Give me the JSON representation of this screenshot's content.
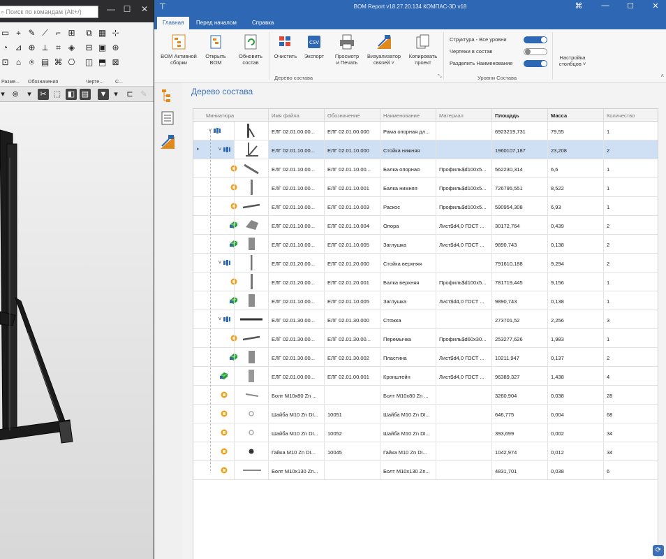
{
  "kompas": {
    "search_placeholder": "Поиск по командам (Alt+/)",
    "group_labels": [
      "Разме...",
      "Обозначения",
      "Черте...",
      "С..."
    ]
  },
  "bom": {
    "title": "BOM Report v18.27.20.134 КОМПАС-3D v18",
    "tabs": [
      "Главная",
      "Перед началом",
      "Справка"
    ],
    "active_tab": "Главная",
    "ribbon": {
      "buttons": [
        {
          "label": "BOM Активной\nсборки"
        },
        {
          "label": "Открыть\nBOM"
        },
        {
          "label": "Обновить\nсостав"
        },
        {
          "label": "Очистить"
        },
        {
          "label": "Экспорт"
        },
        {
          "label": "Просмотр\nи Печать"
        },
        {
          "label": "Визуализатор\nсвязей ˅"
        },
        {
          "label": "Копировать\nпроект"
        }
      ],
      "toggles": [
        {
          "label": "Структура - Все уровни",
          "on": true
        },
        {
          "label": "Чертежи в состав",
          "on": false
        },
        {
          "label": "Разделить Наименование",
          "on": true
        }
      ],
      "columns_button": "Настройка\nстолбцов ˅",
      "group_labels": [
        "Дерево состава",
        "Уровни Состава"
      ]
    },
    "heading": "Дерево состава",
    "columns": [
      "Миниатюра",
      "Имя файла",
      "Обозначение",
      "Наименование",
      "Материал",
      "Площадь",
      "Масса",
      "Количество"
    ],
    "rows": [
      {
        "level": 0,
        "expand": "˅",
        "kind": "asm",
        "file": "ЕЛГ 02.01.00.00...",
        "designation": "ЕЛГ 02.01.00.000",
        "name": "Рама опорная дл...",
        "material": "",
        "area": "6923219,731",
        "mass": "79,55",
        "qty": "1"
      },
      {
        "level": 1,
        "expand": "˅",
        "kind": "asm",
        "file": "ЕЛГ 02.01.10.00...",
        "designation": "ЕЛГ 02.01.10.000",
        "name": "Стойка нижняя",
        "material": "",
        "area": "1960107,187",
        "mass": "23,208",
        "qty": "2",
        "selected": true
      },
      {
        "level": 2,
        "expand": "",
        "kind": "weld",
        "file": "ЕЛГ 02.01.10.00...",
        "designation": "ЕЛГ 02.01.10.00...",
        "name": "Балка опорная",
        "material": "Профиль$d100x5...",
        "area": "562230,314",
        "mass": "6,6",
        "qty": "1"
      },
      {
        "level": 2,
        "expand": "",
        "kind": "weld",
        "file": "ЕЛГ 02.01.10.00...",
        "designation": "ЕЛГ 02.01.10.001",
        "name": "Балка нижняя",
        "material": "Профиль$d100x5...",
        "area": "726795,551",
        "mass": "8,522",
        "qty": "1"
      },
      {
        "level": 2,
        "expand": "",
        "kind": "weld",
        "file": "ЕЛГ 02.01.10.00...",
        "designation": "ЕЛГ 02.01.10.003",
        "name": "Раскос",
        "material": "Профиль$d100x5...",
        "area": "590954,308",
        "mass": "6,93",
        "qty": "1"
      },
      {
        "level": 2,
        "expand": "",
        "kind": "part",
        "file": "ЕЛГ 02.01.10.00...",
        "designation": "ЕЛГ 02.01.10.004",
        "name": "Опора",
        "material": "Лист$d4,0 ГОСТ ...",
        "area": "30172,764",
        "mass": "0,439",
        "qty": "2"
      },
      {
        "level": 2,
        "expand": "",
        "kind": "part",
        "file": "ЕЛГ 02.01.10.00...",
        "designation": "ЕЛГ 02.01.10.005",
        "name": "Заглушка",
        "material": "Лист$d4,0 ГОСТ ...",
        "area": "9890,743",
        "mass": "0,138",
        "qty": "2"
      },
      {
        "level": 1,
        "expand": "˅",
        "kind": "asm",
        "file": "ЕЛГ 02.01.20.00...",
        "designation": "ЕЛГ 02.01.20.000",
        "name": "Стойка верхняя",
        "material": "",
        "area": "791610,188",
        "mass": "9,294",
        "qty": "2"
      },
      {
        "level": 2,
        "expand": "",
        "kind": "weld",
        "file": "ЕЛГ 02.01.20.00...",
        "designation": "ЕЛГ 02.01.20.001",
        "name": "Балка верхняя",
        "material": "Профиль$d100x5...",
        "area": "781719,445",
        "mass": "9,156",
        "qty": "1"
      },
      {
        "level": 2,
        "expand": "",
        "kind": "part",
        "file": "ЕЛГ 02.01.10.00...",
        "designation": "ЕЛГ 02.01.10.005",
        "name": "Заглушка",
        "material": "Лист$d4,0 ГОСТ ...",
        "area": "9890,743",
        "mass": "0,138",
        "qty": "1"
      },
      {
        "level": 1,
        "expand": "˅",
        "kind": "asm",
        "file": "ЕЛГ 02.01.30.00...",
        "designation": "ЕЛГ 02.01.30.000",
        "name": "Стяжка",
        "material": "",
        "area": "273701,52",
        "mass": "2,256",
        "qty": "3"
      },
      {
        "level": 2,
        "expand": "",
        "kind": "weld",
        "file": "ЕЛГ 02.01.30.00...",
        "designation": "ЕЛГ 02.01.30.00...",
        "name": "Перемычка",
        "material": "Профиль$d60x30...",
        "area": "253277,626",
        "mass": "1,983",
        "qty": "1"
      },
      {
        "level": 2,
        "expand": "",
        "kind": "part",
        "file": "ЕЛГ 02.01.30.00...",
        "designation": "ЕЛГ 02.01.30.002",
        "name": "Пластина",
        "material": "Лист$d4,0 ГОСТ ...",
        "area": "10211,947",
        "mass": "0,137",
        "qty": "2"
      },
      {
        "level": 1,
        "expand": "",
        "kind": "part",
        "file": "ЕЛГ 02.01.00.00...",
        "designation": "ЕЛГ 02.01.00.001",
        "name": "Кронштейн",
        "material": "Лист$d4,0 ГОСТ ...",
        "area": "96389,327",
        "mass": "1,438",
        "qty": "4"
      },
      {
        "level": 1,
        "expand": "",
        "kind": "std",
        "file": "Болт М10x80 Zn ...",
        "designation": "",
        "name": "Болт М10x80 Zn ...",
        "material": "",
        "area": "3260,904",
        "mass": "0,038",
        "qty": "28"
      },
      {
        "level": 1,
        "expand": "",
        "kind": "std",
        "file": "Шайба М10 Zn DI...",
        "designation": "10051",
        "name": "Шайба М10 Zn DI...",
        "material": "",
        "area": "646,775",
        "mass": "0,004",
        "qty": "68"
      },
      {
        "level": 1,
        "expand": "",
        "kind": "std",
        "file": "Шайба М10 Zn DI...",
        "designation": "10052",
        "name": "Шайба М10 Zn DI...",
        "material": "",
        "area": "393,699",
        "mass": "0,002",
        "qty": "34"
      },
      {
        "level": 1,
        "expand": "",
        "kind": "std",
        "file": "Гайка М10 Zn DI...",
        "designation": "10045",
        "name": "Гайка М10 Zn DI...",
        "material": "",
        "area": "1042,974",
        "mass": "0,012",
        "qty": "34"
      },
      {
        "level": 1,
        "expand": "",
        "kind": "std",
        "file": "Болт М10x130 Zn...",
        "designation": "",
        "name": "Болт М10x130 Zn...",
        "material": "",
        "area": "4831,701",
        "mass": "0,038",
        "qty": "6"
      }
    ]
  },
  "colors": {
    "accent": "#2e67b4",
    "selection": "#cfe0f5",
    "heading": "#3a70b8"
  }
}
